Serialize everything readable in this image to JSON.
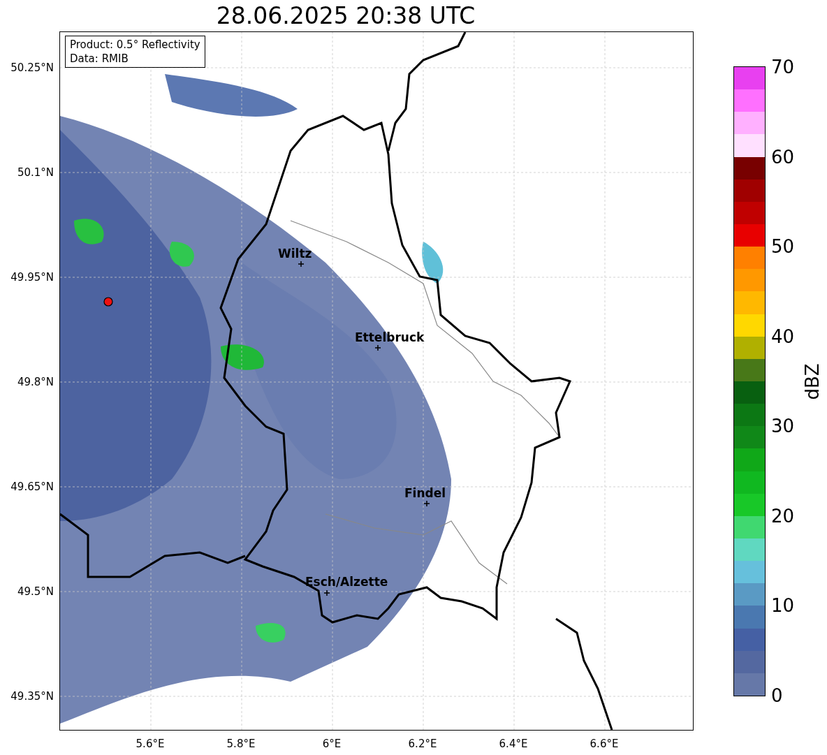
{
  "title": "28.06.2025 20:38 UTC",
  "legend": {
    "lines": [
      "Product: 0.5° Reflectivity",
      "Data: RMIB"
    ]
  },
  "map": {
    "y_ticks": [
      "50.25°N",
      "50.1°N",
      "49.95°N",
      "49.8°N",
      "49.65°N",
      "49.5°N",
      "49.35°N"
    ],
    "x_ticks": [
      "5.6°E",
      "5.8°E",
      "6°E",
      "6.2°E",
      "6.4°E",
      "6.6°E"
    ],
    "cities": [
      {
        "name": "Wiltz"
      },
      {
        "name": "Ettelbruck"
      },
      {
        "name": "Findel"
      },
      {
        "name": "Esch/Alzette"
      }
    ]
  },
  "colorbar": {
    "label": "dBZ",
    "ticks": [
      "70",
      "60",
      "50",
      "40",
      "30",
      "20",
      "10",
      "0"
    ],
    "segments": [
      {
        "color": "#6678a8"
      },
      {
        "color": "#5468a0"
      },
      {
        "color": "#4560a4"
      },
      {
        "color": "#4a78b0"
      },
      {
        "color": "#5a9ac4"
      },
      {
        "color": "#66c0dc"
      },
      {
        "color": "#60d8c0"
      },
      {
        "color": "#40d870"
      },
      {
        "color": "#18c828"
      },
      {
        "color": "#10b820"
      },
      {
        "color": "#10a818"
      },
      {
        "color": "#108818"
      },
      {
        "color": "#0c7814"
      },
      {
        "color": "#086010"
      },
      {
        "color": "#487818"
      },
      {
        "color": "#b0b000"
      },
      {
        "color": "#ffd800"
      },
      {
        "color": "#ffb800"
      },
      {
        "color": "#ff9800"
      },
      {
        "color": "#ff8000"
      },
      {
        "color": "#e80000"
      },
      {
        "color": "#c00000"
      },
      {
        "color": "#a00000"
      },
      {
        "color": "#780000"
      },
      {
        "color": "#ffe0ff"
      },
      {
        "color": "#ffb0ff"
      },
      {
        "color": "#ff70ff"
      },
      {
        "color": "#e840f0"
      }
    ]
  }
}
